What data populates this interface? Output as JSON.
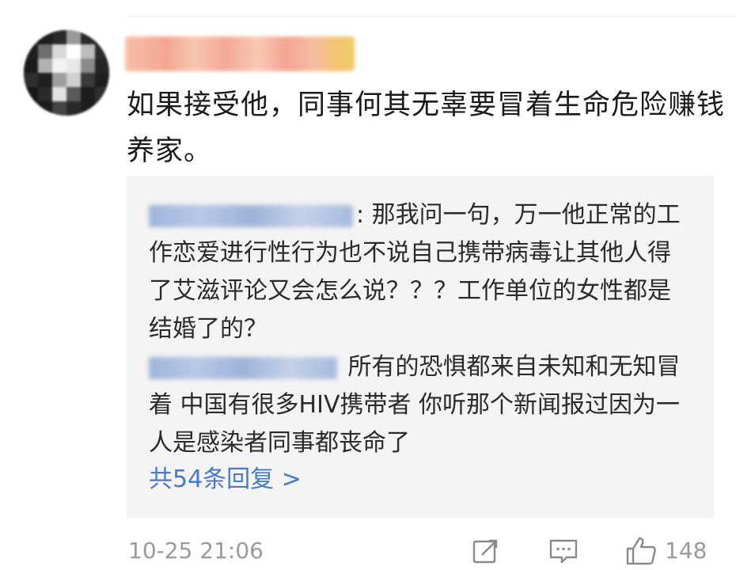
{
  "comment": {
    "text": "如果接受他，同事何其无辜要冒着生命危险赚钱养家。",
    "timestamp": "10-25 21:06",
    "like_count": "148"
  },
  "replies": [
    {
      "text": ": 那我问一句，万一他正常的工作恋爱进行性行为也不说自己携带病毒让其他人得了艾滋评论又会怎么说？？？工作单位的女性都是结婚了的？"
    },
    {
      "text": " 所有的恐惧都来自未知和无知冒着 中国有很多HIV携带者 你听那个新闻报过因为一人是感染者同事都丧命了"
    }
  ],
  "more_replies_label": "共54条回复 >",
  "icons": {
    "share": "share-icon",
    "comment": "comment-icon",
    "like": "thumbs-up-icon"
  },
  "colors": {
    "link": "#4a79c8",
    "meta": "#9a9a9a",
    "reply_bg": "#f4f4f4"
  }
}
